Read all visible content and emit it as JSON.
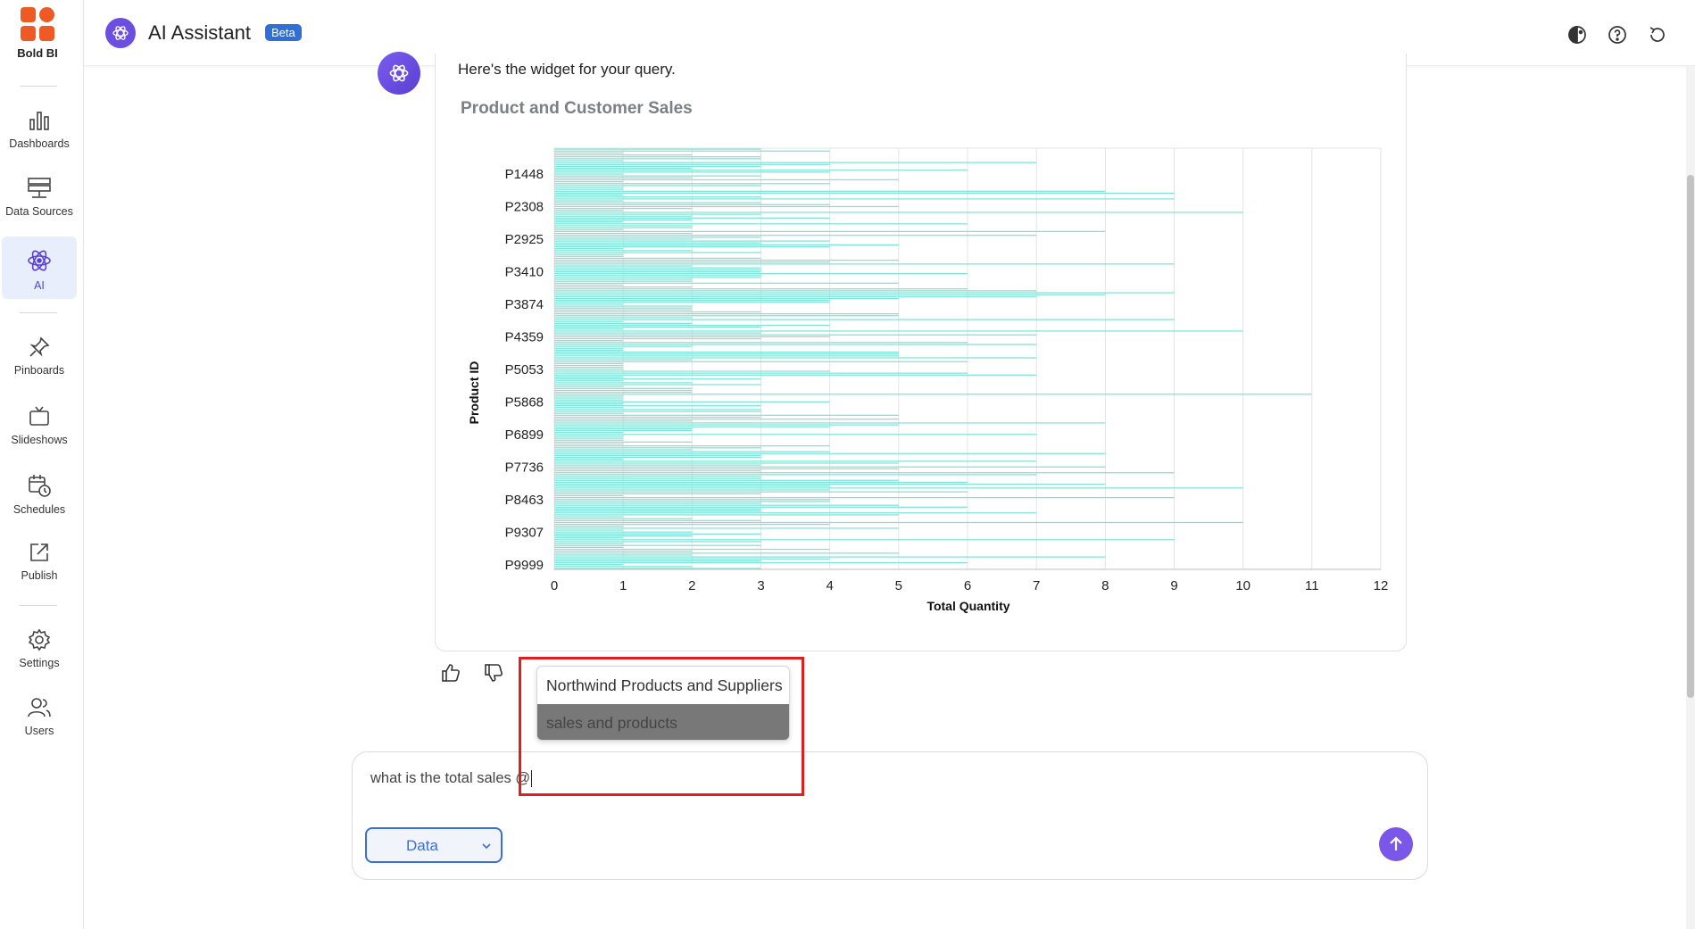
{
  "brand": {
    "name": "Bold BI"
  },
  "sidebar": {
    "items": [
      {
        "label": "Dashboards",
        "icon": "bar-chart-icon"
      },
      {
        "label": "Data Sources",
        "icon": "database-icon"
      },
      {
        "label": "AI",
        "icon": "ai-atom-icon",
        "active": true
      },
      {
        "label": "Pinboards",
        "icon": "pin-icon"
      },
      {
        "label": "Slideshows",
        "icon": "tv-icon"
      },
      {
        "label": "Schedules",
        "icon": "calendar-clock-icon"
      },
      {
        "label": "Publish",
        "icon": "publish-icon"
      },
      {
        "label": "Settings",
        "icon": "gear-icon"
      },
      {
        "label": "Users",
        "icon": "users-icon"
      }
    ]
  },
  "header": {
    "title": "AI Assistant",
    "badge": "Beta",
    "actions": [
      "theme-icon",
      "help-icon",
      "refresh-icon"
    ]
  },
  "chat": {
    "bot_message": "Here's the widget for your query.",
    "widget_title": "Product and Customer Sales",
    "feedback": [
      "thumbs-up-icon",
      "thumbs-down-icon"
    ]
  },
  "chart_data": {
    "type": "bar",
    "orientation": "horizontal",
    "title": "Product and Customer Sales",
    "xlabel": "Total Quantity",
    "ylabel": "Product ID",
    "xlim": [
      0,
      12
    ],
    "xticks": [
      "0",
      "1",
      "2",
      "3",
      "4",
      "5",
      "6",
      "7",
      "8",
      "9",
      "10",
      "11",
      "12"
    ],
    "categories": [
      "P1448",
      "P2308",
      "P2925",
      "P3410",
      "P3874",
      "P4359",
      "P5053",
      "P5868",
      "P6899",
      "P7736",
      "P8463",
      "P9307",
      "P9999"
    ],
    "bar_color": "#7fe3d6",
    "grid": true
  },
  "mention": {
    "options": [
      "Northwind Products and Suppliers",
      "sales and products"
    ],
    "selected_index": 1
  },
  "composer": {
    "text": "what is the total sales @",
    "data_button": "Data"
  },
  "colors": {
    "accent": "#6c4fe0",
    "primary": "#3a6fd8",
    "highlight": "#e01e1e"
  }
}
